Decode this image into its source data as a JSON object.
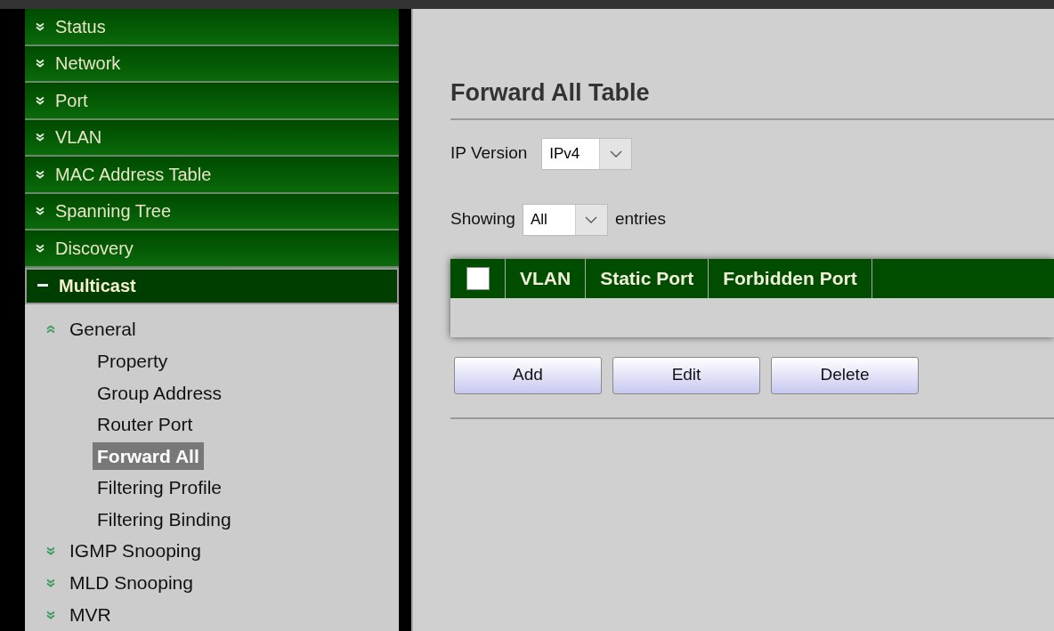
{
  "sidebar": {
    "items": [
      {
        "label": "Status",
        "expanded": false
      },
      {
        "label": "Network",
        "expanded": false
      },
      {
        "label": "Port",
        "expanded": false
      },
      {
        "label": "VLAN",
        "expanded": false
      },
      {
        "label": "MAC Address Table",
        "expanded": false
      },
      {
        "label": "Spanning Tree",
        "expanded": false
      },
      {
        "label": "Discovery",
        "expanded": false
      },
      {
        "label": "Multicast",
        "expanded": true,
        "children": [
          {
            "label": "General",
            "expanded": true,
            "children": [
              {
                "label": "Property",
                "selected": false
              },
              {
                "label": "Group Address",
                "selected": false
              },
              {
                "label": "Router Port",
                "selected": false
              },
              {
                "label": "Forward All",
                "selected": true
              },
              {
                "label": "Filtering Profile",
                "selected": false
              },
              {
                "label": "Filtering Binding",
                "selected": false
              }
            ]
          },
          {
            "label": "IGMP Snooping",
            "expanded": false
          },
          {
            "label": "MLD Snooping",
            "expanded": false
          },
          {
            "label": "MVR",
            "expanded": false
          }
        ]
      }
    ]
  },
  "page": {
    "title": "Forward All Table",
    "ip_version": {
      "label": "IP Version",
      "value": "IPv4"
    },
    "showing": {
      "label": "Showing",
      "value": "All",
      "suffix": "entries"
    },
    "table": {
      "select_all": {
        "checked": false
      },
      "columns": [
        "VLAN",
        "Static Port",
        "Forbidden Port"
      ]
    },
    "buttons": [
      "Add",
      "Edit",
      "Delete"
    ]
  }
}
